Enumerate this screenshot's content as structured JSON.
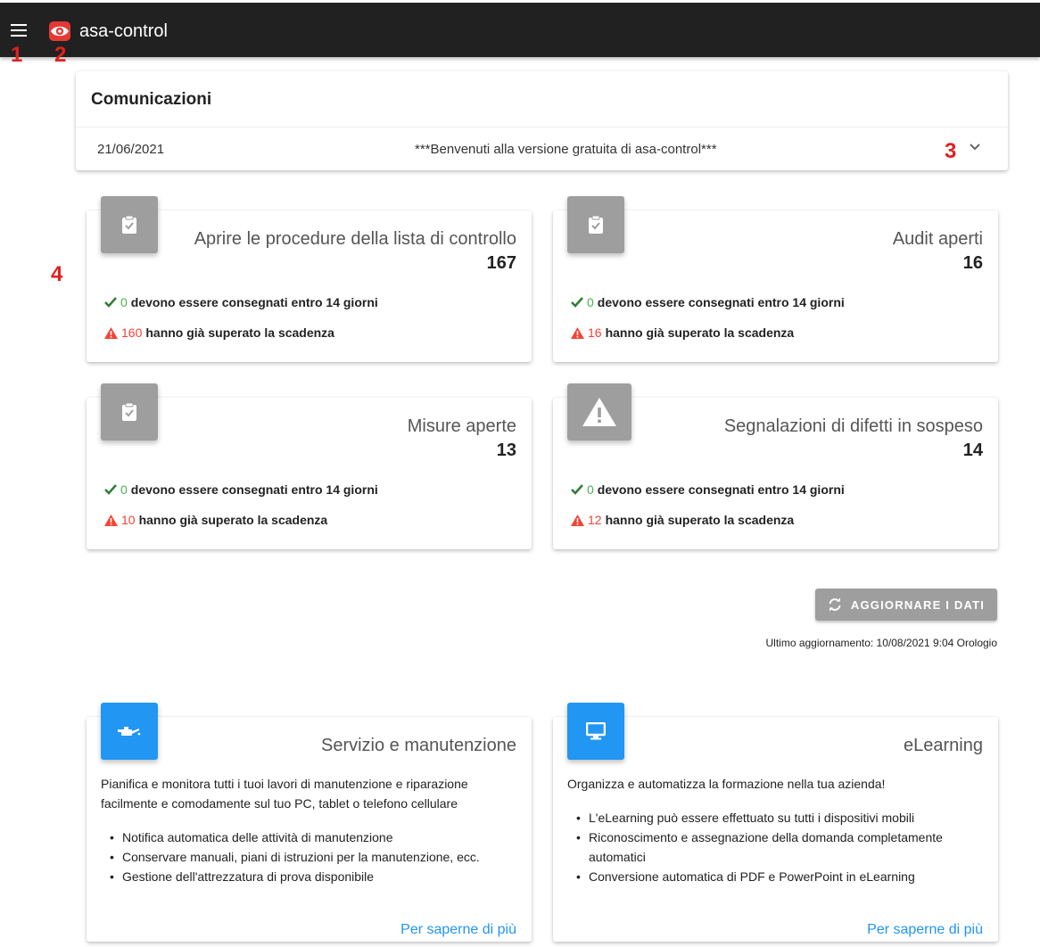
{
  "header": {
    "app_title": "asa-control"
  },
  "annotations": [
    "1",
    "2",
    "3",
    "4"
  ],
  "communications": {
    "title": "Comunicazioni",
    "items": [
      {
        "date": "21/06/2021",
        "message": "***Benvenuti alla versione gratuita di asa-control***"
      }
    ]
  },
  "stats": [
    {
      "title": "Aprire le procedure della lista di controllo",
      "value": "167",
      "due_count": "0",
      "due_text": "devono essere consegnati entro 14 giorni",
      "overdue_count": "160",
      "overdue_text": "hanno già superato la scadenza",
      "icon": "clipboard-check-icon"
    },
    {
      "title": "Audit aperti",
      "value": "16",
      "due_count": "0",
      "due_text": "devono essere consegnati entro 14 giorni",
      "overdue_count": "16",
      "overdue_text": "hanno già superato la scadenza",
      "icon": "clipboard-check-icon"
    },
    {
      "title": "Misure aperte",
      "value": "13",
      "due_count": "0",
      "due_text": "devono essere consegnati entro 14 giorni",
      "overdue_count": "10",
      "overdue_text": "hanno già superato la scadenza",
      "icon": "clipboard-check-icon"
    },
    {
      "title": "Segnalazioni di difetti in sospeso",
      "value": "14",
      "due_count": "0",
      "due_text": "devono essere consegnati entro 14 giorni",
      "overdue_count": "12",
      "overdue_text": "hanno già superato la scadenza",
      "icon": "warning-icon"
    }
  ],
  "refresh": {
    "label": "AGGIORNARE I DATI",
    "last_update": "Ultimo aggiornamento: 10/08/2021 9:04 Orologio"
  },
  "info_cards": [
    {
      "title": "Servizio e manutenzione",
      "icon": "oil-can-icon",
      "description": "Pianifica e monitora tutti i tuoi lavori di manutenzione e riparazione facilmente e comodamente sul tuo PC, tablet o telefono cellulare",
      "bullets": [
        "Notifica automatica delle attività di manutenzione",
        "Conservare manuali, piani di istruzioni per la manutenzione, ecc.",
        "Gestione dell'attrezzatura di prova disponibile"
      ],
      "link": "Per saperne di più"
    },
    {
      "title": "eLearning",
      "icon": "monitor-icon",
      "description": "Organizza e automatizza la formazione nella tua azienda!",
      "bullets": [
        "L'eLearning può essere effettuato su tutti i dispositivi mobili",
        "Riconoscimento e assegnazione della domanda completamente automatici",
        "Conversione automatica di PDF e PowerPoint in eLearning"
      ],
      "link": "Per saperne di più"
    }
  ],
  "colors": {
    "topbar": "#212121",
    "accent_blue": "#2196f3",
    "success_green": "#4caf50",
    "danger_red": "#f44336",
    "icon_grey": "#9e9e9e",
    "annotation_red": "#e02020"
  }
}
